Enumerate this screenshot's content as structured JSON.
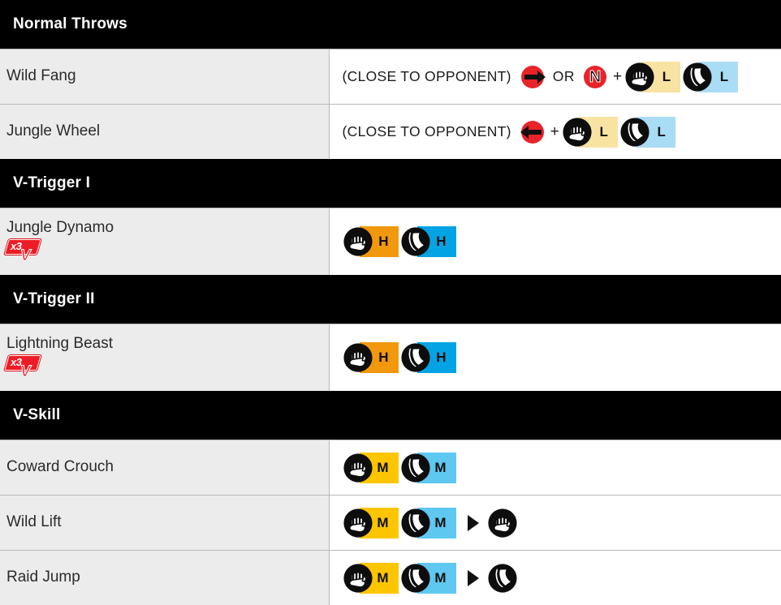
{
  "colors": {
    "section_bg": "#000000",
    "section_text": "#ffffff",
    "name_cell_bg": "#ececec",
    "cmd_cell_bg": "#ffffff",
    "border": "#b9b9b9",
    "light_punch": "#f8e3a3",
    "light_kick": "#a9dcf5",
    "medium_punch": "#fdc500",
    "medium_kick": "#5ec8f0",
    "heavy_punch": "#f2980c",
    "heavy_kick": "#04a3e3",
    "direction_red": "#e8232a",
    "badge_red": "#ee1c25"
  },
  "sections": [
    {
      "title": "Normal Throws",
      "moves": [
        {
          "name": "Wild Fang",
          "badge": null,
          "command": {
            "prefix": "(CLOSE TO OPPONENT)",
            "tokens": [
              {
                "kind": "direction",
                "dir": "right",
                "icon": "arrow-right-icon"
              },
              {
                "kind": "separator",
                "label": "OR"
              },
              {
                "kind": "neutral",
                "label": "N",
                "icon": "neutral-stick-icon"
              },
              {
                "kind": "plus",
                "label": "+"
              },
              {
                "kind": "button",
                "input": "punch",
                "icon": "punch-fist-icon",
                "strength": "L",
                "color": "#f8e3a3"
              },
              {
                "kind": "button",
                "input": "kick",
                "icon": "kick-boot-icon",
                "strength": "L",
                "color": "#a9dcf5"
              }
            ]
          }
        },
        {
          "name": "Jungle Wheel",
          "badge": null,
          "command": {
            "prefix": "(CLOSE TO OPPONENT)",
            "tokens": [
              {
                "kind": "direction",
                "dir": "left",
                "icon": "arrow-left-icon"
              },
              {
                "kind": "plus",
                "label": "+"
              },
              {
                "kind": "button",
                "input": "punch",
                "icon": "punch-fist-icon",
                "strength": "L",
                "color": "#f8e3a3"
              },
              {
                "kind": "button",
                "input": "kick",
                "icon": "kick-boot-icon",
                "strength": "L",
                "color": "#a9dcf5"
              }
            ]
          }
        }
      ]
    },
    {
      "title": "V-Trigger I",
      "moves": [
        {
          "name": "Jungle Dynamo",
          "badge": {
            "multiplier": "x3",
            "meter": "V"
          },
          "command": {
            "prefix": "",
            "tokens": [
              {
                "kind": "button",
                "input": "punch",
                "icon": "punch-fist-icon",
                "strength": "H",
                "color": "#f2980c"
              },
              {
                "kind": "button",
                "input": "kick",
                "icon": "kick-boot-icon",
                "strength": "H",
                "color": "#04a3e3"
              }
            ]
          }
        }
      ]
    },
    {
      "title": "V-Trigger II",
      "moves": [
        {
          "name": "Lightning Beast",
          "badge": {
            "multiplier": "x3",
            "meter": "V"
          },
          "command": {
            "prefix": "",
            "tokens": [
              {
                "kind": "button",
                "input": "punch",
                "icon": "punch-fist-icon",
                "strength": "H",
                "color": "#f2980c"
              },
              {
                "kind": "button",
                "input": "kick",
                "icon": "kick-boot-icon",
                "strength": "H",
                "color": "#04a3e3"
              }
            ]
          }
        }
      ]
    },
    {
      "title": "V-Skill",
      "moves": [
        {
          "name": "Coward Crouch",
          "badge": null,
          "command": {
            "prefix": "",
            "tokens": [
              {
                "kind": "button",
                "input": "punch",
                "icon": "punch-fist-icon",
                "strength": "M",
                "color": "#fdc500"
              },
              {
                "kind": "button",
                "input": "kick",
                "icon": "kick-boot-icon",
                "strength": "M",
                "color": "#5ec8f0"
              }
            ]
          }
        },
        {
          "name": "Wild Lift",
          "badge": null,
          "command": {
            "prefix": "",
            "tokens": [
              {
                "kind": "button",
                "input": "punch",
                "icon": "punch-fist-icon",
                "strength": "M",
                "color": "#fdc500"
              },
              {
                "kind": "button",
                "input": "kick",
                "icon": "kick-boot-icon",
                "strength": "M",
                "color": "#5ec8f0"
              },
              {
                "kind": "follow",
                "icon": "play-triangle-icon"
              },
              {
                "kind": "button",
                "input": "punch",
                "icon": "punch-fist-icon",
                "strength": "",
                "color": ""
              }
            ]
          }
        },
        {
          "name": "Raid Jump",
          "badge": null,
          "command": {
            "prefix": "",
            "tokens": [
              {
                "kind": "button",
                "input": "punch",
                "icon": "punch-fist-icon",
                "strength": "M",
                "color": "#fdc500"
              },
              {
                "kind": "button",
                "input": "kick",
                "icon": "kick-boot-icon",
                "strength": "M",
                "color": "#5ec8f0"
              },
              {
                "kind": "follow",
                "icon": "play-triangle-icon"
              },
              {
                "kind": "button",
                "input": "kick",
                "icon": "kick-boot-icon",
                "strength": "",
                "color": ""
              }
            ]
          }
        }
      ]
    }
  ]
}
